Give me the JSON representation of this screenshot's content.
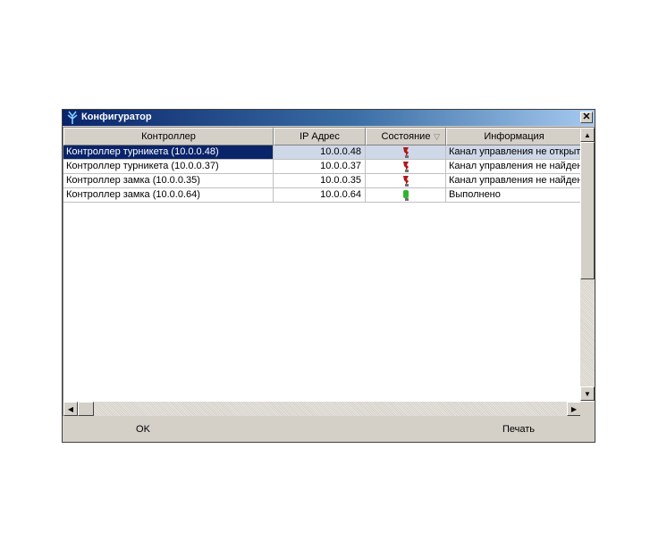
{
  "window": {
    "title": "Конфигуратор",
    "close_glyph": "✕"
  },
  "table": {
    "columns": [
      "Контроллер",
      "IP Адрес",
      "Состояние",
      "Информация"
    ],
    "rows": [
      {
        "controller": "Контроллер турникета (10.0.0.48)",
        "ip": "10.0.0.48",
        "status": "error",
        "info": "Канал управления не открыт."
      },
      {
        "controller": "Контроллер турникета (10.0.0.37)",
        "ip": "10.0.0.37",
        "status": "error",
        "info": "Канал управления не найден."
      },
      {
        "controller": "Контроллер замка  (10.0.0.35)",
        "ip": "10.0.0.35",
        "status": "error",
        "info": "Канал управления не найден."
      },
      {
        "controller": "Контроллер замка  (10.0.0.64)",
        "ip": "10.0.0.64",
        "status": "ok",
        "info": "Выполнено"
      }
    ],
    "selected_row": 0,
    "sort_indicator": "▽"
  },
  "buttons": {
    "ok_label": "OK",
    "print_label": "Печать"
  },
  "colors": {
    "titlebar_start": "#0a246a",
    "titlebar_end": "#a6caf0",
    "status_error": "#b01818",
    "status_ok": "#2fb52f"
  },
  "icons": {
    "app": "trident-icon",
    "status_error": "red-signal-icon",
    "status_ok": "green-signal-icon"
  }
}
